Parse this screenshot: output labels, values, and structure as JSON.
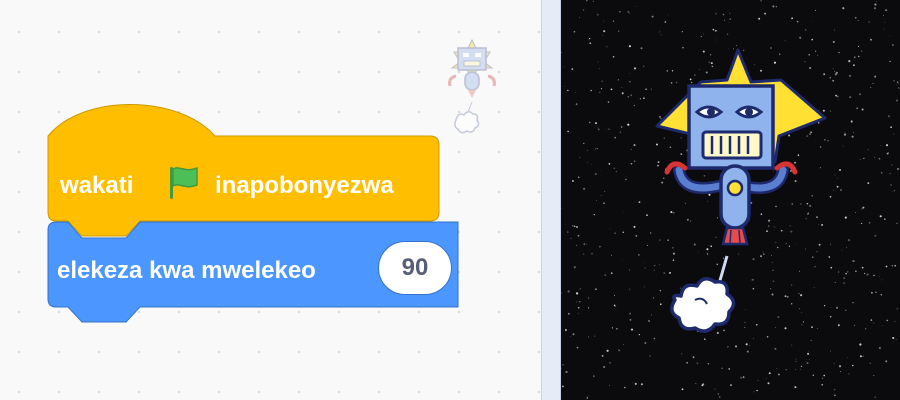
{
  "hat_block": {
    "label_start": "wakati",
    "label_end": "inapobonyezwa",
    "flag_icon": "green-flag-icon",
    "color": "#ffbf00",
    "border_color": "#cc9900"
  },
  "motion_block": {
    "label": "elekeza kwa mwelekeo",
    "input_value": "90",
    "color": "#4c97ff",
    "border_color": "#3373cc"
  },
  "sprite_thumbnail": {
    "icon": "robot-sprite-icon"
  },
  "stage": {
    "background": "starry-space",
    "sprite_icon": "robot-sprite-icon",
    "smoke_icon": "smoke-puff-icon"
  }
}
